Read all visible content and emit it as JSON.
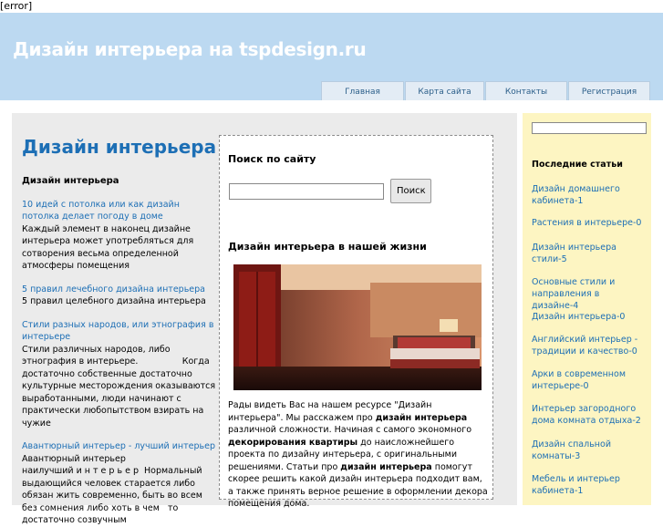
{
  "error_text": "[error]",
  "header": {
    "site_title": "Дизайн интерьера на tspdesign.ru"
  },
  "nav": [
    "Главная",
    "Карта сайта",
    "Контакты",
    "Регистрация"
  ],
  "left": {
    "page_title": "Дизайн интерьера",
    "section_heading": "Дизайн интерьера",
    "posts": [
      {
        "title": "10 идей с потолка или как дизайн потолка делает погоду в доме",
        "excerpt": "Каждый элемент в наконец дизайне интерьера может употребляться для сотворения весьма определенной атмосферы помещения"
      },
      {
        "title": "5 правил лечебного дизайна интерьера",
        "excerpt": "5 правил целебного дизайна интерьера"
      },
      {
        "title": "Стили разных народов, или этнография в интерьере",
        "excerpt": "Стили различных народов, либо этнография в интерьере.                Когда достаточно собственные достаточно культурные месторождения оказываются выработанными, люди начинают с практически любопытством взирать на чужие"
      },
      {
        "title": "Авантюрный интерьер - лучший интерьер",
        "excerpt": "Авантюрный интерьер                наилучший и н т е р ь е р  Нормальный выдающийся человек старается либо обязан жить современно, быть во всем без сомнения либо хоть в чем   то достаточно созвучным"
      }
    ]
  },
  "middle": {
    "search_title": "Поиск по сайту",
    "search_value": "",
    "search_button": "Поиск",
    "section_title": "Дизайн интерьера в нашей жизни",
    "intro_1": "Рады видеть Вас на нашем ресурсе \"Дизайн интерьера\". Мы расскажем про ",
    "intro_b1": "дизайн интерьера",
    "intro_2": " различной сложности. Начиная с самого экономного ",
    "intro_b2": "декорирования квартиры",
    "intro_3": " до наисложнейшего проекта по дизайну интерьера, с оригинальными решениями. Статьи про ",
    "intro_b3": "дизайн интерьера",
    "intro_4": " помогут скорее решить какой дизайн интерьера подходит вам, а также принять верное решение в оформлении декора помещения дома."
  },
  "right": {
    "search_value": "",
    "recent_title": "Последние статьи",
    "recent": [
      "Дизайн домашнего кабинета-1",
      "Растения в интерьере-0",
      "Дизайн интерьера стили-5",
      "Основные стили и направления в дизайне-4",
      "Дизайн интерьера-0",
      "Английский интерьер - традиции и качество-0",
      "Арки в современном интерьере-0",
      "Интерьер загородного дома комната отдыха-2",
      "Дизайн спальной комнаты-3",
      "Мебель и интерьер кабинета-1"
    ]
  },
  "icons": {
    "photo": "bedroom-photo"
  },
  "colors": {
    "header_bg": "#bcd9f1",
    "link": "#1d6fb5",
    "sidebar_bg": "#fdf5c2",
    "main_bg": "#ebebeb"
  }
}
